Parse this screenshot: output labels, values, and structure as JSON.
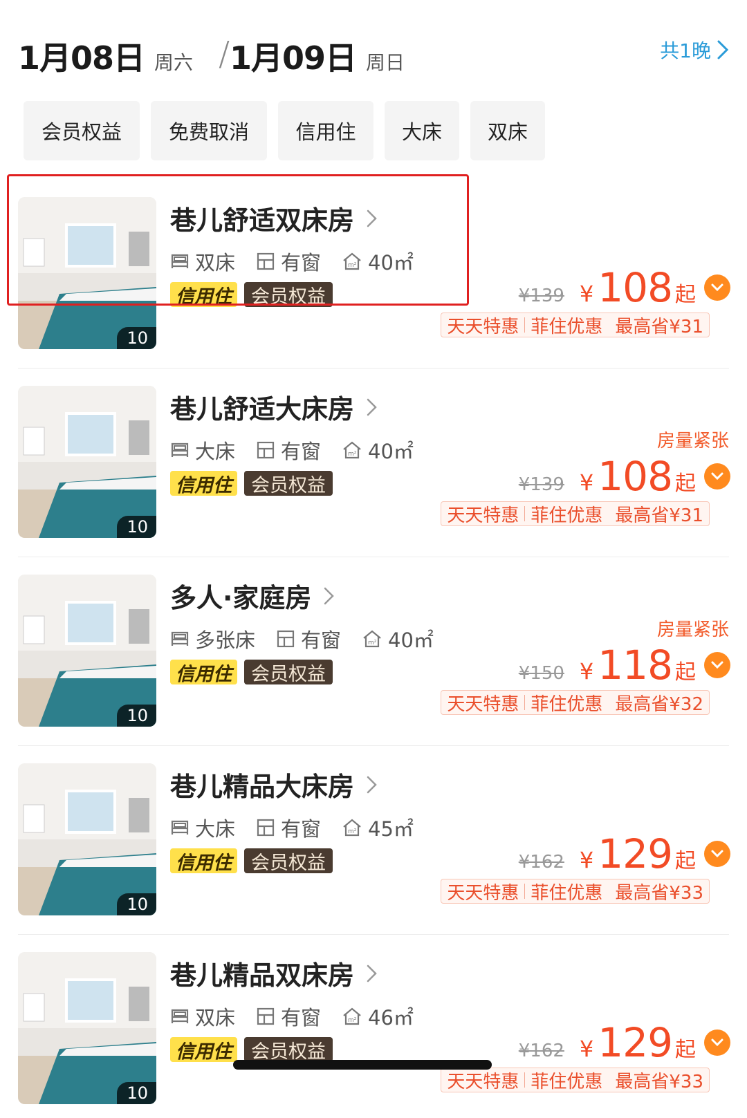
{
  "dates": {
    "checkin": "1月08日",
    "checkin_week": "周六",
    "separator": "/",
    "checkout": "1月09日",
    "checkout_week": "周日",
    "nights": "共1晚"
  },
  "filters": [
    "会员权益",
    "免费取消",
    "信用住",
    "大床",
    "双床"
  ],
  "rooms": [
    {
      "name": "巷儿舒适双床房",
      "bed": "双床",
      "window": "有窗",
      "area": "40㎡",
      "badge_credit": "信用住",
      "badge_member": "会员权益",
      "scarcity": "",
      "original_price": "¥139",
      "currency": "¥",
      "price": "108",
      "price_suffix": "起",
      "promo_1": "天天特惠",
      "promo_2": "菲住优惠",
      "promo_save": "最高省¥31",
      "photo_count": "10"
    },
    {
      "name": "巷儿舒适大床房",
      "bed": "大床",
      "window": "有窗",
      "area": "40㎡",
      "badge_credit": "信用住",
      "badge_member": "会员权益",
      "scarcity": "房量紧张",
      "original_price": "¥139",
      "currency": "¥",
      "price": "108",
      "price_suffix": "起",
      "promo_1": "天天特惠",
      "promo_2": "菲住优惠",
      "promo_save": "最高省¥31",
      "photo_count": "10"
    },
    {
      "name": "多人·家庭房",
      "bed": "多张床",
      "window": "有窗",
      "area": "40㎡",
      "badge_credit": "信用住",
      "badge_member": "会员权益",
      "scarcity": "房量紧张",
      "original_price": "¥150",
      "currency": "¥",
      "price": "118",
      "price_suffix": "起",
      "promo_1": "天天特惠",
      "promo_2": "菲住优惠",
      "promo_save": "最高省¥32",
      "photo_count": "10"
    },
    {
      "name": "巷儿精品大床房",
      "bed": "大床",
      "window": "有窗",
      "area": "45㎡",
      "badge_credit": "信用住",
      "badge_member": "会员权益",
      "scarcity": "",
      "original_price": "¥162",
      "currency": "¥",
      "price": "129",
      "price_suffix": "起",
      "promo_1": "天天特惠",
      "promo_2": "菲住优惠",
      "promo_save": "最高省¥33",
      "photo_count": "10"
    },
    {
      "name": "巷儿精品双床房",
      "bed": "双床",
      "window": "有窗",
      "area": "46㎡",
      "badge_credit": "信用住",
      "badge_member": "会员权益",
      "scarcity": "",
      "original_price": "¥162",
      "currency": "¥",
      "price": "129",
      "price_suffix": "起",
      "promo_1": "天天特惠",
      "promo_2": "菲住优惠",
      "promo_save": "最高省¥33",
      "photo_count": "10"
    }
  ],
  "colors": {
    "accent_blue": "#2a9bd8",
    "price_red": "#f24b25",
    "badge_yellow": "#ffe04b",
    "badge_brown": "#4a3b30",
    "highlight_red": "#e02020",
    "dropdown_orange": "#ff8a1e"
  },
  "icons": {
    "nights_chevron": "chevron-right-icon",
    "bed": "bed-icon",
    "window": "window-icon",
    "area": "house-area-icon",
    "expand": "chevron-down-icon"
  }
}
